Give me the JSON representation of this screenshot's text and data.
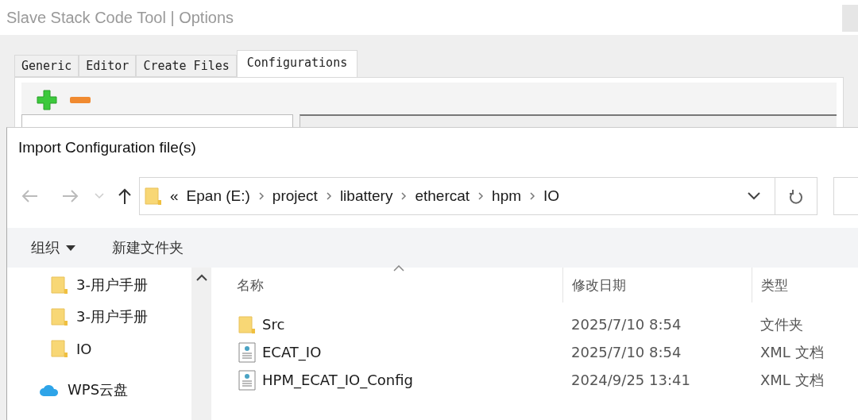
{
  "window": {
    "title": "Slave Stack Code Tool | Options"
  },
  "tabs": [
    {
      "label": "Generic",
      "selected": false
    },
    {
      "label": "Editor",
      "selected": false
    },
    {
      "label": "Create Files",
      "selected": false
    },
    {
      "label": "Configurations",
      "selected": true
    }
  ],
  "dialog": {
    "title": "Import Configuration file(s)",
    "overflow": "«",
    "path": [
      "Epan (E:)",
      "project",
      "libattery",
      "ethercat",
      "hpm",
      "IO"
    ],
    "toolbar": {
      "organize": "组织",
      "new_folder": "新建文件夹"
    },
    "nav_pane": [
      {
        "label": "3-用户手册",
        "kind": "folder"
      },
      {
        "label": "3-用户手册",
        "kind": "folder"
      },
      {
        "label": "IO",
        "kind": "folder"
      },
      {
        "label": "WPS云盘",
        "kind": "cloud"
      }
    ],
    "columns": [
      "名称",
      "修改日期",
      "类型"
    ],
    "rows": [
      {
        "name": "Src",
        "date": "2025/7/10 8:54",
        "type": "文件夹",
        "kind": "folder"
      },
      {
        "name": "ECAT_IO",
        "date": "2025/7/10 8:54",
        "type": "XML 文档",
        "kind": "xml"
      },
      {
        "name": "HPM_ECAT_IO_Config",
        "date": "2024/9/25 13:41",
        "type": "XML 文档",
        "kind": "xml"
      }
    ]
  }
}
